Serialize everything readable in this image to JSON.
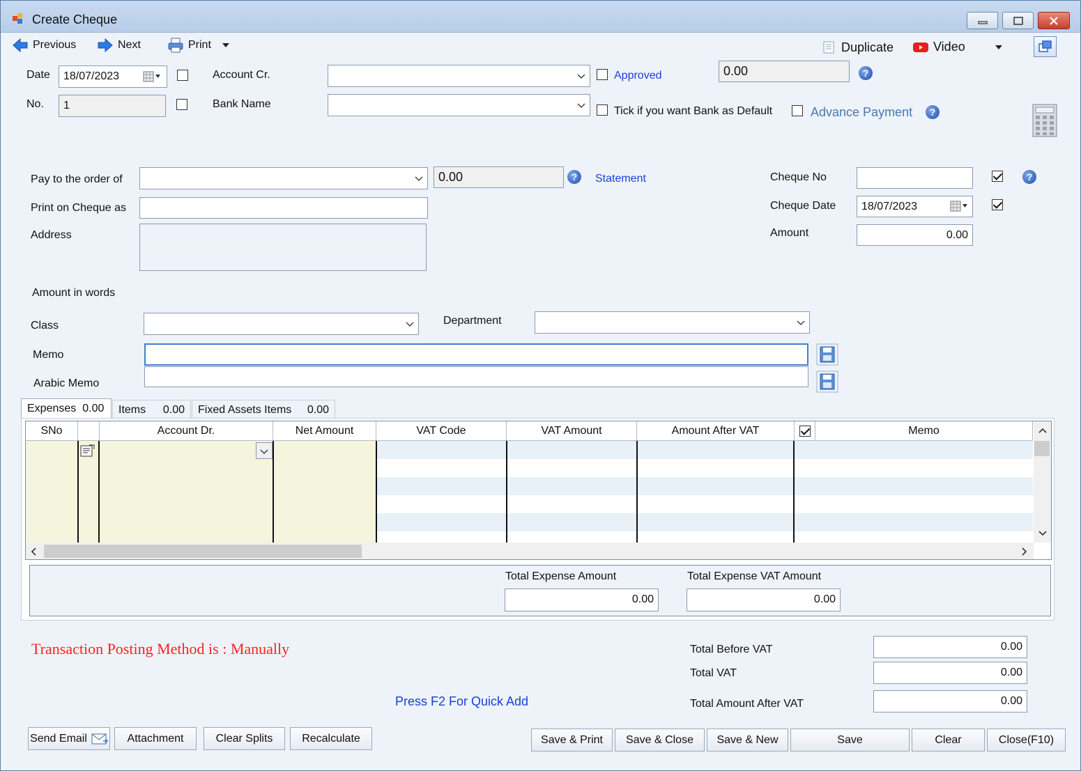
{
  "window": {
    "title": "Create Cheque"
  },
  "toolbar": {
    "previous": "Previous",
    "next": "Next",
    "print": "Print",
    "duplicate": "Duplicate",
    "video": "Video"
  },
  "header": {
    "date_label": "Date",
    "date_value": "18/07/2023",
    "no_label": "No.",
    "no_value": "1",
    "account_cr_label": "Account Cr.",
    "account_cr_value": "",
    "bank_name_label": "Bank Name",
    "bank_name_value": "",
    "approved_label": "Approved",
    "approved_checked": false,
    "balance_value": "0.00",
    "bank_default_label": "Tick if you want Bank as Default",
    "advance_payment_label": "Advance Payment"
  },
  "payee": {
    "pay_to_label": "Pay to the order of",
    "pay_to_value": "",
    "balance_value": "0.00",
    "statement_link": "Statement",
    "print_on_cheque_label": "Print on Cheque as",
    "print_on_cheque_value": "",
    "address_label": "Address",
    "address_value": "",
    "amount_in_words_label": "Amount in words"
  },
  "cheque": {
    "cheque_no_label": "Cheque No",
    "cheque_no_value": "",
    "cheque_no_checked": true,
    "cheque_date_label": "Cheque Date",
    "cheque_date_value": "18/07/2023",
    "cheque_date_checked": true,
    "amount_label": "Amount",
    "amount_value": "0.00"
  },
  "classification": {
    "class_label": "Class",
    "class_value": "",
    "department_label": "Department",
    "department_value": "",
    "memo_label": "Memo",
    "memo_value": "",
    "arabic_memo_label": "Arabic Memo",
    "arabic_memo_value": ""
  },
  "tabs": [
    {
      "label": "Expenses",
      "value": "0.00",
      "active": true
    },
    {
      "label": "Items",
      "value": "0.00",
      "active": false
    },
    {
      "label": "Fixed Assets Items",
      "value": "0.00",
      "active": false
    }
  ],
  "grid": {
    "columns": [
      "SNo",
      "",
      "Account Dr.",
      "Net Amount",
      "VAT Code",
      "VAT Amount",
      "Amount After VAT",
      "",
      "Memo"
    ]
  },
  "expense_totals": {
    "total_expense_amount_label": "Total Expense Amount",
    "total_expense_amount_value": "0.00",
    "total_expense_vat_label": "Total Expense VAT Amount",
    "total_expense_vat_value": "0.00"
  },
  "footer": {
    "posting_method": "Transaction Posting Method is : Manually",
    "quick_add_hint": "Press F2 For Quick Add",
    "total_before_vat_label": "Total Before VAT",
    "total_before_vat_value": "0.00",
    "total_vat_label": "Total VAT",
    "total_vat_value": "0.00",
    "total_after_vat_label": "Total Amount After VAT",
    "total_after_vat_value": "0.00"
  },
  "actions": {
    "send_email": "Send Email",
    "attachment": "Attachment",
    "clear_splits": "Clear Splits",
    "recalculate": "Recalculate",
    "save_print": "Save & Print",
    "save_close": "Save & Close",
    "save_new": "Save & New",
    "save": "Save",
    "clear": "Clear",
    "close": "Close(F10)"
  },
  "colors": {
    "window_bg": "#eef3f9",
    "link_blue": "#1a3fd6",
    "posting_red": "#ff2020",
    "grid_entry_bg": "#f5f4dc"
  }
}
